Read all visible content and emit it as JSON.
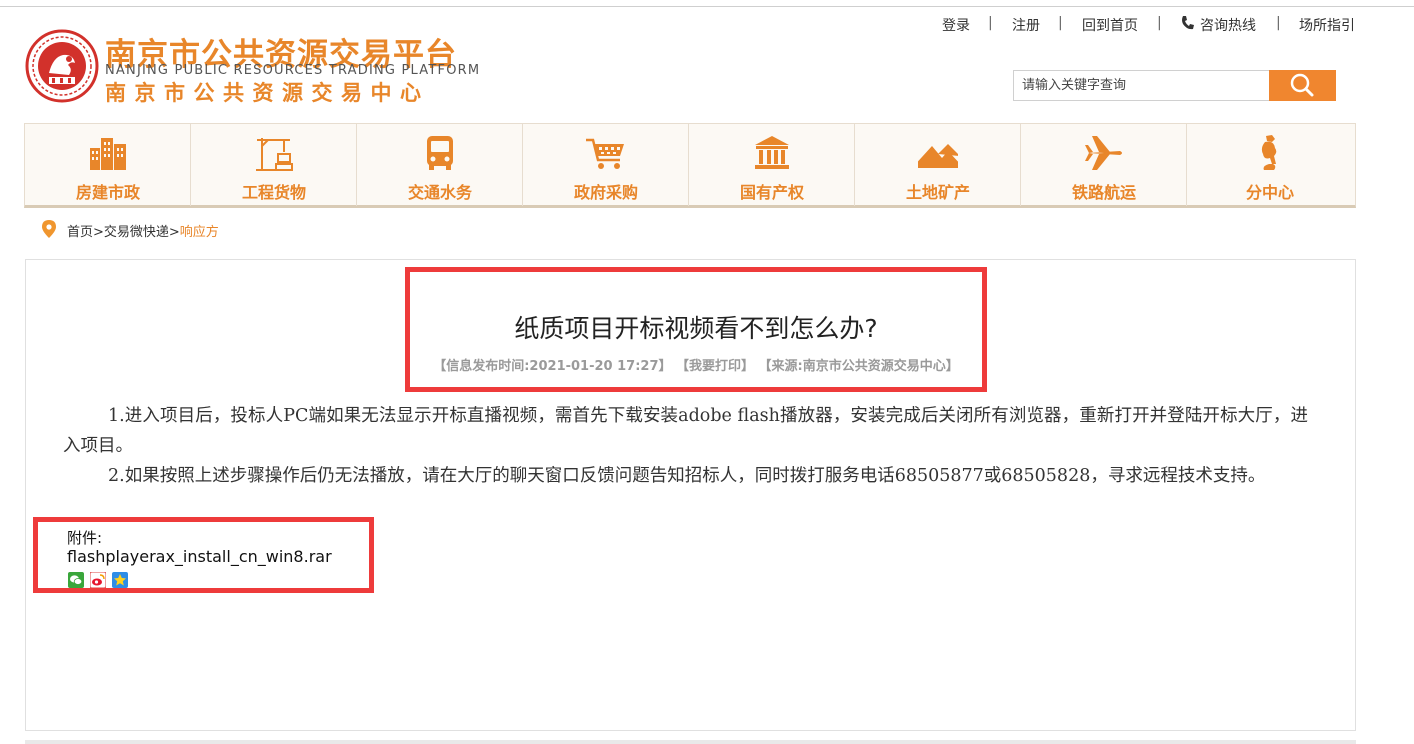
{
  "header": {
    "logo": {
      "title_cn": "南京市公共资源交易平台",
      "title_en": "NANJING PUBLIC RESOURCES TRADING PLATFORM",
      "subtitle_cn": "南京市公共资源交易中心"
    },
    "links": {
      "login": "登录",
      "register": "注册",
      "home": "回到首页",
      "hotline": "咨询热线",
      "guide": "场所指引",
      "separator": "|"
    },
    "search": {
      "placeholder": "请输入关键字查询"
    }
  },
  "nav": {
    "items": [
      {
        "label": "房建市政",
        "icon": "buildings-icon"
      },
      {
        "label": "工程货物",
        "icon": "crane-icon"
      },
      {
        "label": "交通水务",
        "icon": "bus-icon"
      },
      {
        "label": "政府采购",
        "icon": "cart-icon"
      },
      {
        "label": "国有产权",
        "icon": "bank-icon"
      },
      {
        "label": "土地矿产",
        "icon": "mountain-icon"
      },
      {
        "label": "铁路航运",
        "icon": "plane-icon"
      },
      {
        "label": "分中心",
        "icon": "mascot-icon"
      }
    ]
  },
  "breadcrumb": {
    "path": "首页>交易微快递>",
    "current": "响应方"
  },
  "article": {
    "title": "纸质项目开标视频看不到怎么办?",
    "meta": "【信息发布时间:2021-01-20 17:27】 【我要打印】 【来源:南京市公共资源交易中心】",
    "paragraphs": [
      "1.进入项目后，投标人PC端如果无法显示开标直播视频，需首先下载安装adobe flash播放器，安装完成后关闭所有浏览器，重新打开并登陆开标大厅，进入项目。",
      "2.如果按照上述步骤操作后仍无法播放，请在大厅的聊天窗口反馈问题告知招标人，同时拨打服务电话68505877或68505828，寻求远程技术支持。"
    ],
    "attachment_label": "附件:",
    "attachment_file": "flashplayerax_install_cn_win8.rar"
  },
  "colors": {
    "accent": "#e8862a",
    "search_button": "#f0862f",
    "highlight_border": "#ee3b3b"
  }
}
